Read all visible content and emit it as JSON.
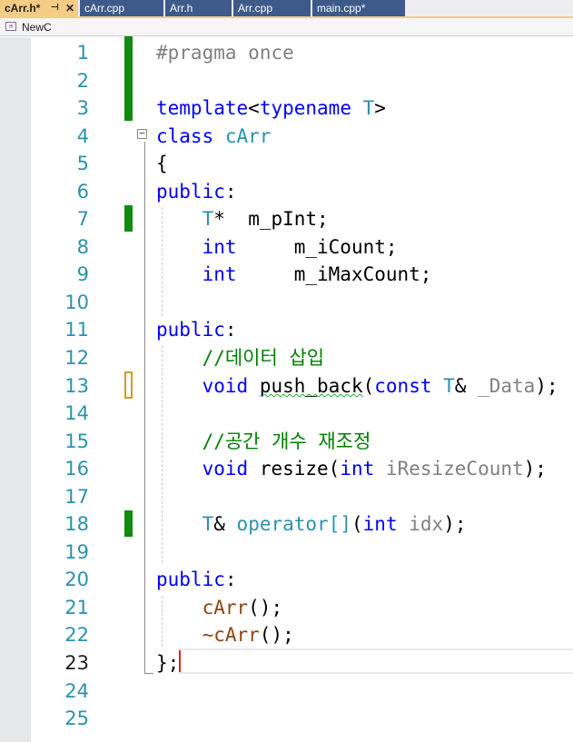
{
  "tabs": [
    {
      "label": "cArr.h*",
      "pin": "⊣",
      "close": "✕",
      "active": true
    },
    {
      "label": "cArr.cpp",
      "active": false
    },
    {
      "label": "Arr.h",
      "active": false
    },
    {
      "label": "Arr.cpp",
      "active": false
    },
    {
      "label": "main.cpp*",
      "active": false
    }
  ],
  "nav": {
    "scope": "NewC",
    "icon": "class-icon"
  },
  "editor": {
    "current_line": 23,
    "line_numbers": [
      "1",
      "2",
      "3",
      "4",
      "5",
      "6",
      "7",
      "8",
      "9",
      "10",
      "11",
      "12",
      "13",
      "14",
      "15",
      "16",
      "17",
      "18",
      "19",
      "20",
      "21",
      "22",
      "23",
      "24",
      "25"
    ],
    "lines": [
      "#pragma once",
      "",
      "template<typename T>",
      "class cArr",
      "{",
      "public:",
      "    T*  m_pInt;",
      "    int     m_iCount;",
      "    int     m_iMaxCount;",
      "",
      "public:",
      "    //데이터 삽입",
      "    void push_back(const T& _Data);",
      "",
      "    //공간 개수 재조정",
      "    void resize(int iResizeCount);",
      "",
      "    T& operator[](int idx);",
      "",
      "public:",
      "    cArr();",
      "    ~cArr();",
      "};",
      "",
      ""
    ],
    "tokens": {
      "pragma": "#pragma",
      "once": "once",
      "template": "template",
      "lt": "<",
      "typename": "typename",
      "T": "T",
      "gt": ">",
      "class_kw": "class",
      "cArr": "cArr",
      "brace_open": "{",
      "public": "public",
      "colon": ":",
      "star": "*",
      "m_pInt": "m_pInt;",
      "int": "int",
      "m_iCount": "m_iCount;",
      "m_iMaxCount": "m_iMaxCount;",
      "comment_insert": "//데이터 삽입",
      "void": "void",
      "push_back": "push_back",
      "lparen": "(",
      "const": "const",
      "amp": "&",
      "_Data": "_Data",
      "rparen_semi": ");",
      "comment_resize": "//공간 개수 재조정",
      "resize": "resize",
      "iResizeCount": "iResizeCount",
      "operator": "operator",
      "brackets": "[]",
      "idx": "idx",
      "ctor": "cArr",
      "parens_semi": "();",
      "dtor": "~cArr",
      "brace_close": "};"
    }
  },
  "colors": {
    "keyword": "#0000ff",
    "type": "#2b91af",
    "comment": "#008000",
    "change_bar": "#108a10",
    "active_tab": "#f5cc84",
    "inactive_tab": "#3d5a8a"
  }
}
